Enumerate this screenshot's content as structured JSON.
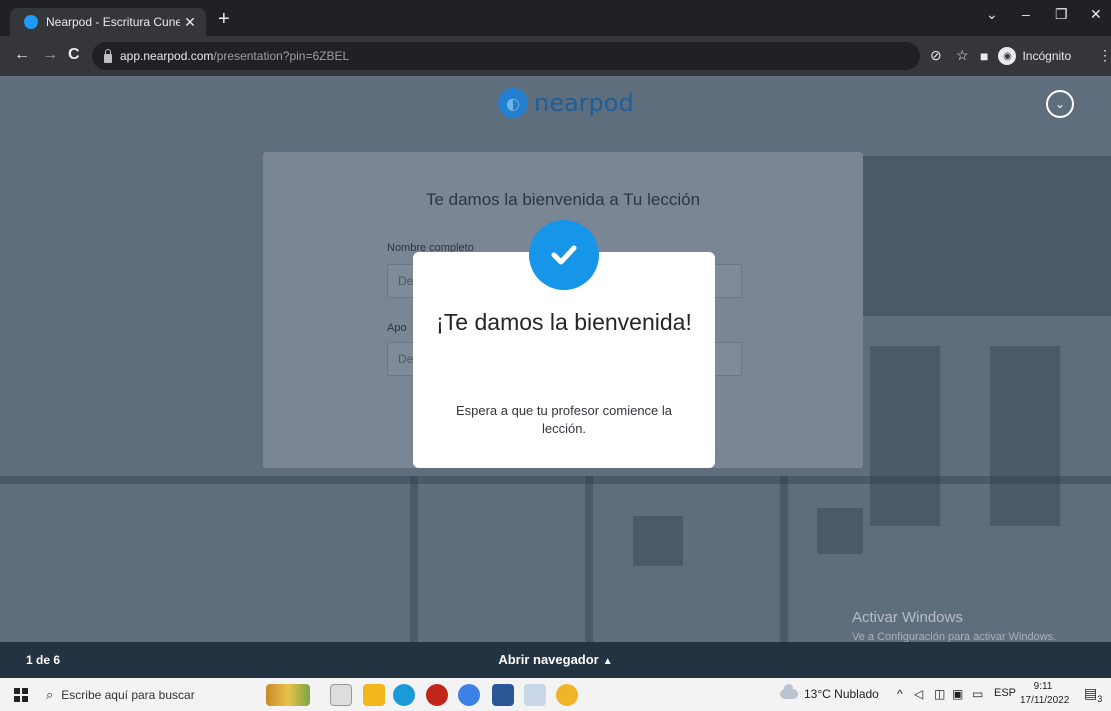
{
  "browser": {
    "tab_title": "Nearpod - Escritura Cuneiforme",
    "tab_close": "✕",
    "new_tab": "+",
    "url_host": "app.nearpod.com",
    "url_path": "/presentation?pin=6ZBEL",
    "incognito_label": "Incógnito"
  },
  "nearpod": {
    "logo_text": "nearpod",
    "form": {
      "title": "Te damos la bienvenida a Tu lección",
      "name_label": "Nombre completo",
      "name_placeholder": "De",
      "second_label": "Apo",
      "second_placeholder": "De"
    },
    "modal": {
      "title": "¡Te damos la bienvenida!",
      "message": "Espera a que tu profesor comience la lección."
    },
    "bottom": {
      "slide_counter": "1 de 6",
      "open_nav": "Abrir navegador"
    }
  },
  "watermark": {
    "line1": "Activar Windows",
    "line2": "Ve a Configuración para activar Windows."
  },
  "taskbar": {
    "search_placeholder": "Escribe aquí para buscar",
    "weather": "13°C Nublado",
    "language": "ESP",
    "time": "9:11",
    "date": "17/11/2022",
    "notifications": "3"
  },
  "colors": {
    "accent": "#1795e8",
    "page_overlay": "#5f6e7d",
    "bottom_bar": "#243342"
  }
}
